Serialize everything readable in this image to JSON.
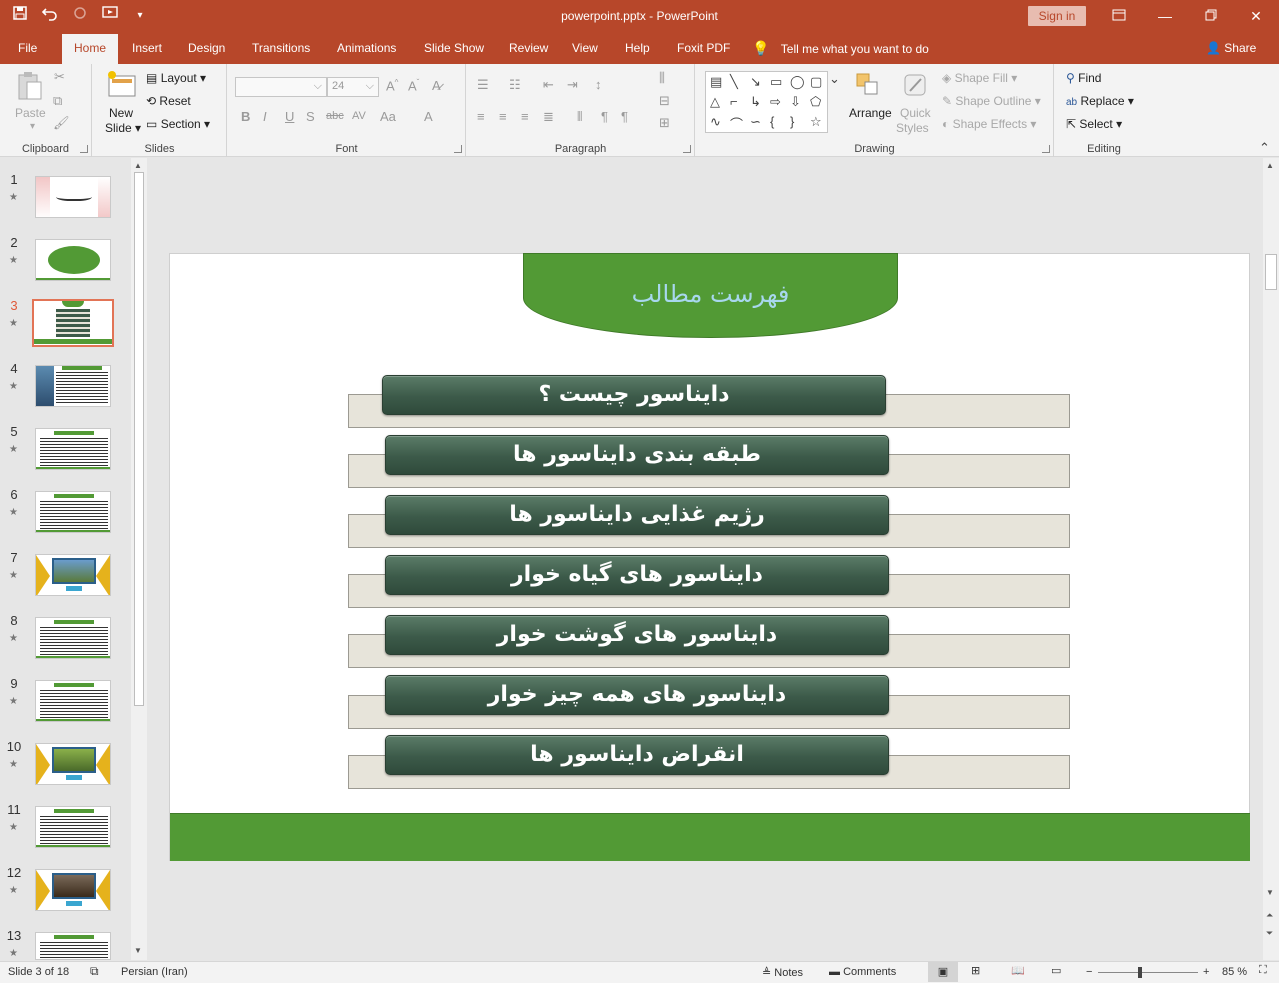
{
  "app": {
    "title": "powerpoint.pptx  -  PowerPoint",
    "signin_label": "Sign in",
    "colors": {
      "accent": "#b7472a",
      "slide_green": "#529a35",
      "pill": "#3c5a49",
      "title_text": "#a8d7ee",
      "band": "#e7e4da"
    }
  },
  "qat": {
    "icons": [
      "save-icon",
      "undo-icon",
      "redo-icon",
      "start-from-beginning-icon",
      "customize-qat-icon"
    ]
  },
  "tabs": [
    {
      "label": "File"
    },
    {
      "label": "Home"
    },
    {
      "label": "Insert"
    },
    {
      "label": "Design"
    },
    {
      "label": "Transitions"
    },
    {
      "label": "Animations"
    },
    {
      "label": "Slide Show"
    },
    {
      "label": "Review"
    },
    {
      "label": "View"
    },
    {
      "label": "Help"
    },
    {
      "label": "Foxit PDF"
    }
  ],
  "tell_me": "Tell me what you want to do",
  "share_label": "Share",
  "ribbon": {
    "clipboard": {
      "paste": "Paste",
      "group": "Clipboard"
    },
    "slides": {
      "new_slide_1": "New",
      "new_slide_2": "Slide",
      "layout": "Layout",
      "reset": "Reset",
      "section": "Section",
      "group": "Slides"
    },
    "font": {
      "font_size": "24",
      "group": "Font"
    },
    "paragraph": {
      "group": "Paragraph"
    },
    "drawing": {
      "arrange": "Arrange",
      "quick_styles_1": "Quick",
      "quick_styles_2": "Styles",
      "shape_fill": "Shape Fill",
      "shape_outline": "Shape Outline",
      "shape_effects": "Shape Effects",
      "group": "Drawing"
    },
    "editing": {
      "find": "Find",
      "replace": "Replace",
      "select": "Select",
      "group": "Editing"
    }
  },
  "thumbnails": [
    {
      "num": "1"
    },
    {
      "num": "2"
    },
    {
      "num": "3"
    },
    {
      "num": "4"
    },
    {
      "num": "5"
    },
    {
      "num": "6"
    },
    {
      "num": "7"
    },
    {
      "num": "8"
    },
    {
      "num": "9"
    },
    {
      "num": "10"
    },
    {
      "num": "11"
    },
    {
      "num": "12"
    },
    {
      "num": "13"
    }
  ],
  "slide": {
    "title": "فهرست مطالب",
    "items": [
      "دایناسور چیست ؟",
      "طبقه بندی دایناسور ها",
      "رژیم غذایی دایناسور ها",
      "دایناسور های گیاه خوار",
      "دایناسور های گوشت خوار",
      "دایناسور های همه چیز خوار",
      "انقراض دایناسور ها"
    ]
  },
  "status": {
    "slide_of": "Slide 3 of 18",
    "language": "Persian (Iran)",
    "notes": "Notes",
    "comments": "Comments",
    "zoom_minus": "−",
    "zoom_plus": "+",
    "zoom": "85 %",
    "zoom_value": 85
  }
}
